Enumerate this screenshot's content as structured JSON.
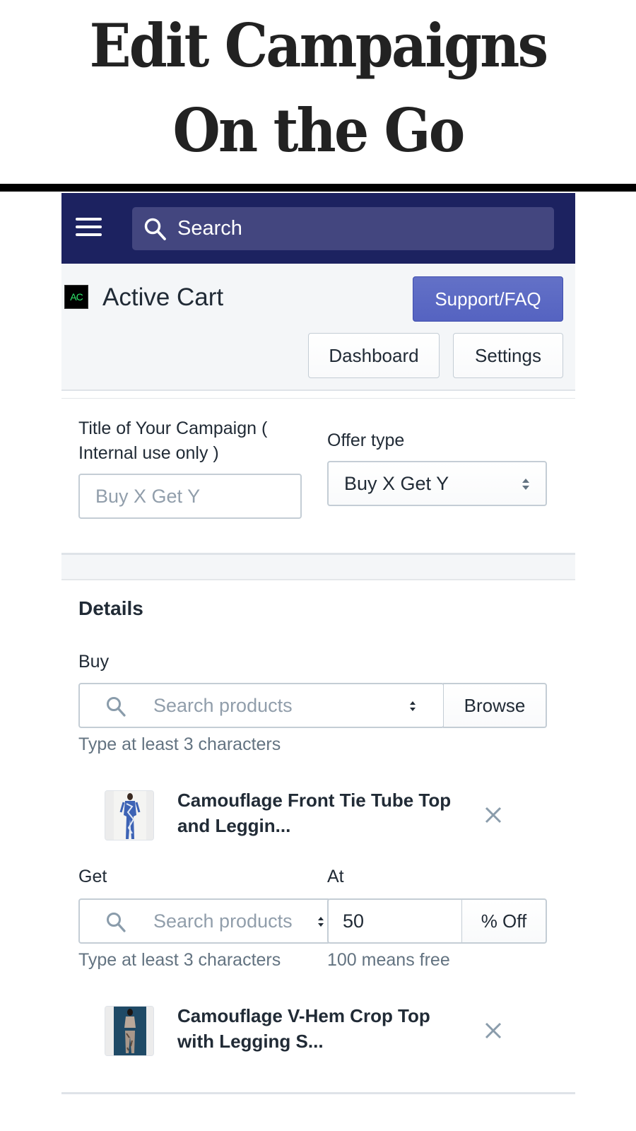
{
  "hero": {
    "line1": "Edit Campaigns",
    "line2": "On the Go"
  },
  "topbar": {
    "menu_icon": "hamburger-menu-icon",
    "search_icon": "search-icon",
    "search_placeholder": "Search",
    "background_color": "#1c2260"
  },
  "header": {
    "logo_text": "AC",
    "app_name": "Active Cart",
    "support_button": "Support/FAQ",
    "dashboard_button": "Dashboard",
    "settings_button": "Settings",
    "accent_color": "#5c6ac4"
  },
  "campaign": {
    "title_label": "Title of Your Campaign ( Internal use only )",
    "title_placeholder": "Buy X Get Y",
    "title_value": "",
    "offer_type_label": "Offer type",
    "offer_type_value": "Buy X Get Y"
  },
  "details": {
    "heading": "Details",
    "buy": {
      "label": "Buy",
      "search_placeholder": "Search products",
      "browse_button": "Browse",
      "help_text": "Type at least 3 characters",
      "product": {
        "name": "Camouflage Front Tie Tube Top and Leggin...",
        "remove_icon": "close-icon"
      }
    },
    "get": {
      "label": "Get",
      "search_placeholder": "Search products",
      "help_text": "Type at least 3 characters",
      "product": {
        "name": "Camouflage V-Hem Crop Top with Legging S...",
        "remove_icon": "close-icon"
      }
    },
    "at": {
      "label": "At",
      "value": "50",
      "suffix": "% Off",
      "help_text": "100 means free"
    }
  }
}
